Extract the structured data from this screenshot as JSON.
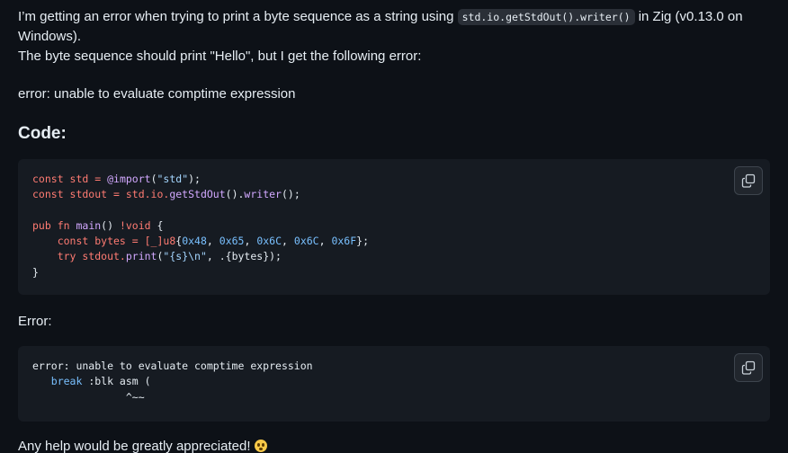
{
  "intro": {
    "before_code": "I’m getting an error when trying to print a byte sequence as a string using ",
    "inline_code": "std.io.getStdOut().writer()",
    "after_code": " in Zig (v0.13.0 on Windows).",
    "line2": "The byte sequence should print \"Hello\", but I get the following error:"
  },
  "error_line": "error: unable to evaluate comptime expression",
  "code_heading": "Code:",
  "code_block": {
    "l1_a": "const std = ",
    "l1_b": "@import",
    "l1_c": "(",
    "l1_d": "\"std\"",
    "l1_e": ");",
    "l2_a": "const stdout = std.io.",
    "l2_b": "getStdOut",
    "l2_c": "().",
    "l2_d": "writer",
    "l2_e": "();",
    "l4_a": "pub fn ",
    "l4_b": "main",
    "l4_c": "() ",
    "l4_d": "!void",
    "l4_e": " {",
    "l5_a": "    const bytes = [_]",
    "l5_b": "u8",
    "l5_c": "{",
    "l5_n1": "0x48",
    "l5_s1": ", ",
    "l5_n2": "0x65",
    "l5_s2": ", ",
    "l5_n3": "0x6C",
    "l5_s3": ", ",
    "l5_n4": "0x6C",
    "l5_s4": ", ",
    "l5_n5": "0x6F",
    "l5_d": "};",
    "l6_a": "    try stdout.",
    "l6_b": "print",
    "l6_c": "(",
    "l6_d": "\"{s}\\n\"",
    "l6_e": ", .{bytes});",
    "l7": "}"
  },
  "error_heading": "Error:",
  "error_block": {
    "l1": "error: unable to evaluate comptime expression",
    "l2_a": "   break",
    "l2_b": " :blk asm (",
    "l3": "               ^~~"
  },
  "closing": "Any help would be greatly appreciated!",
  "icons": {
    "copy": "copy-icon",
    "emoji": "flushed-face-emoji"
  }
}
